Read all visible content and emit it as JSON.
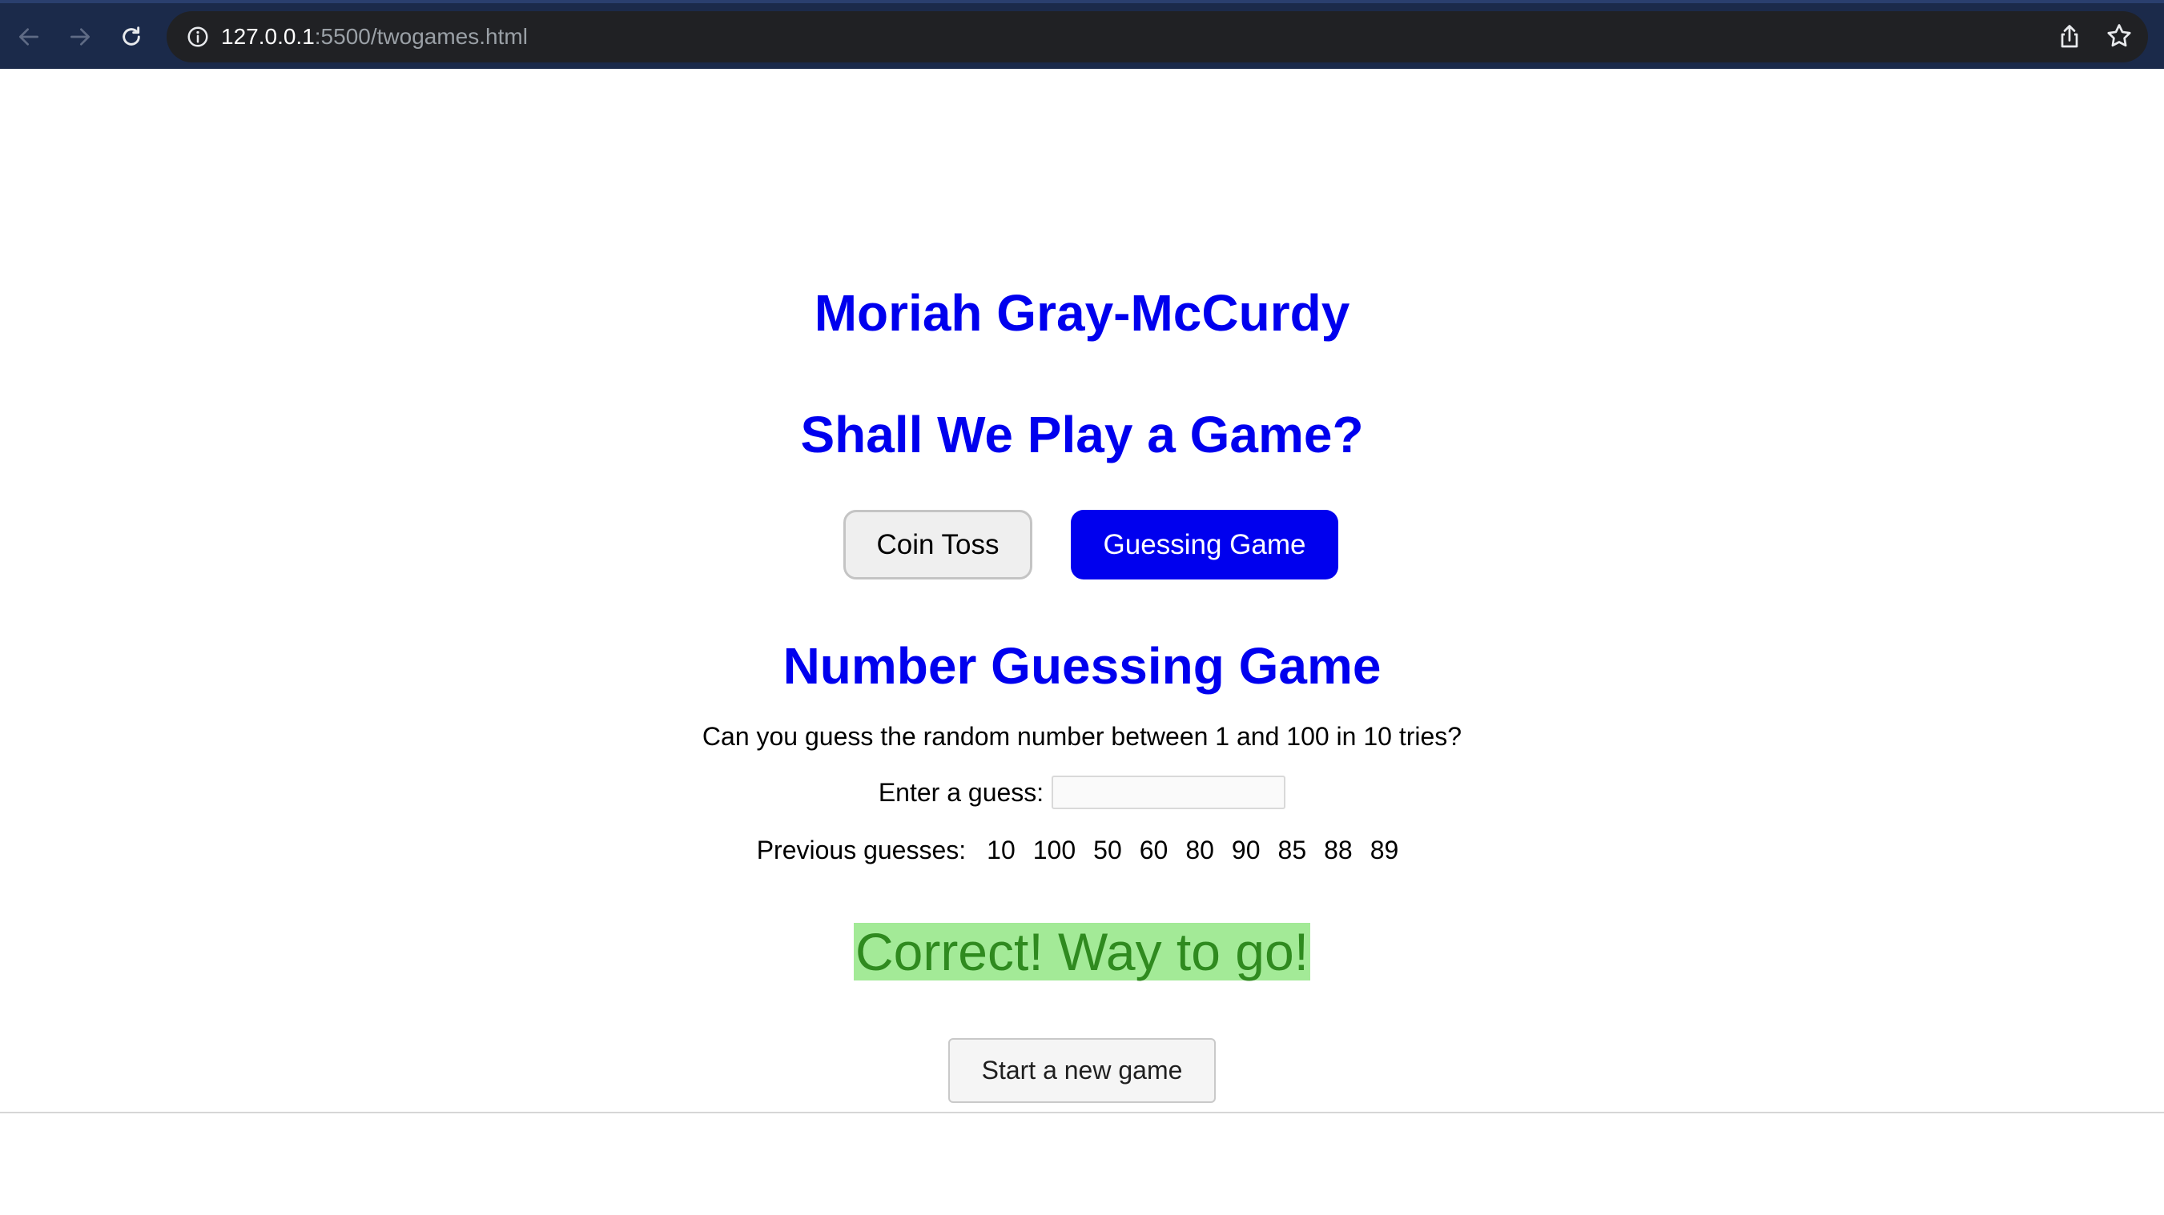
{
  "browser": {
    "url_host": "127.0.0.1",
    "url_path": ":5500/twogames.html",
    "icons": [
      "back-arrow-icon",
      "forward-arrow-icon",
      "reload-icon",
      "info-icon",
      "share-icon",
      "star-icon"
    ]
  },
  "page": {
    "author_heading": "Moriah Gray-McCurdy",
    "main_heading": "Shall We Play a Game?",
    "buttons": {
      "coin_toss": "Coin Toss",
      "guessing_game": "Guessing Game"
    },
    "game": {
      "title": "Number Guessing Game",
      "instructions": "Can you guess the random number between 1 and 100 in 10 tries?",
      "guess_label": "Enter a guess:",
      "guess_value": "",
      "previous_label": "Previous guesses:",
      "previous_guesses": [
        "10",
        "100",
        "50",
        "60",
        "80",
        "90",
        "85",
        "88",
        "89"
      ],
      "result_message": "Correct! Way to go!",
      "new_game_label": "Start a new game"
    },
    "colors": {
      "heading": "#0000ee",
      "active_button": "#0000ee",
      "success_bg": "#a3ea97",
      "success_text": "#2f8a1f"
    }
  }
}
